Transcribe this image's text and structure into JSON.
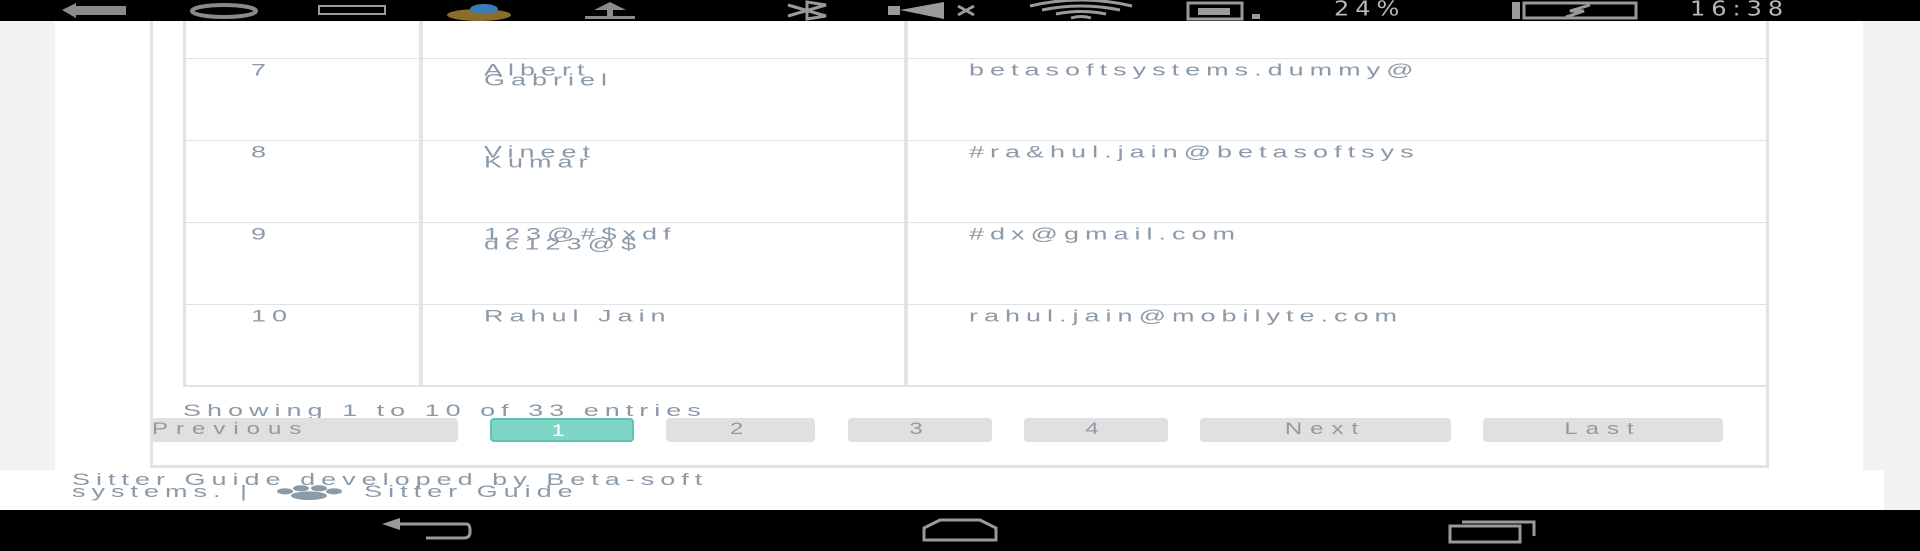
{
  "status_bar": {
    "battery_percent": "24%",
    "time": "16:38",
    "icons": [
      "back-arrow-icon",
      "sync-icon",
      "screen-icon",
      "bird-icon",
      "upload-icon",
      "bluetooth-icon",
      "mute-icon",
      "wifi-icon",
      "sim-icon",
      "battery-icon"
    ]
  },
  "table": {
    "rows": [
      {
        "num": "7",
        "name": "Albert\nGabriel",
        "email": "betasoftsystems.dummy@"
      },
      {
        "num": "8",
        "name": "Vineet\nKumar",
        "email": "#ra&hul.jain@betasoftsys"
      },
      {
        "num": "9",
        "name": "123@#$xdf\ndc123@$",
        "email": "#dx@gmail.com"
      },
      {
        "num": "10",
        "name": "Rahul Jain",
        "email": "rahul.jain@mobilyte.com"
      }
    ]
  },
  "pagination": {
    "info": "Showing 1 to 10 of 33 entries",
    "previous": "Previous",
    "pages": [
      "1",
      "2",
      "3",
      "4"
    ],
    "active_page": "1",
    "next": "Next",
    "last": "Last",
    "active_color": "#7fd6c6"
  },
  "footer": {
    "text_before": "Sitter Guide developed by Beta-soft",
    "text_line2": "systems. |",
    "brand": "Sitter Guide",
    "icon": "paw-icon"
  },
  "nav_bar": {
    "icons": [
      "back-icon",
      "home-icon",
      "recents-icon"
    ]
  }
}
